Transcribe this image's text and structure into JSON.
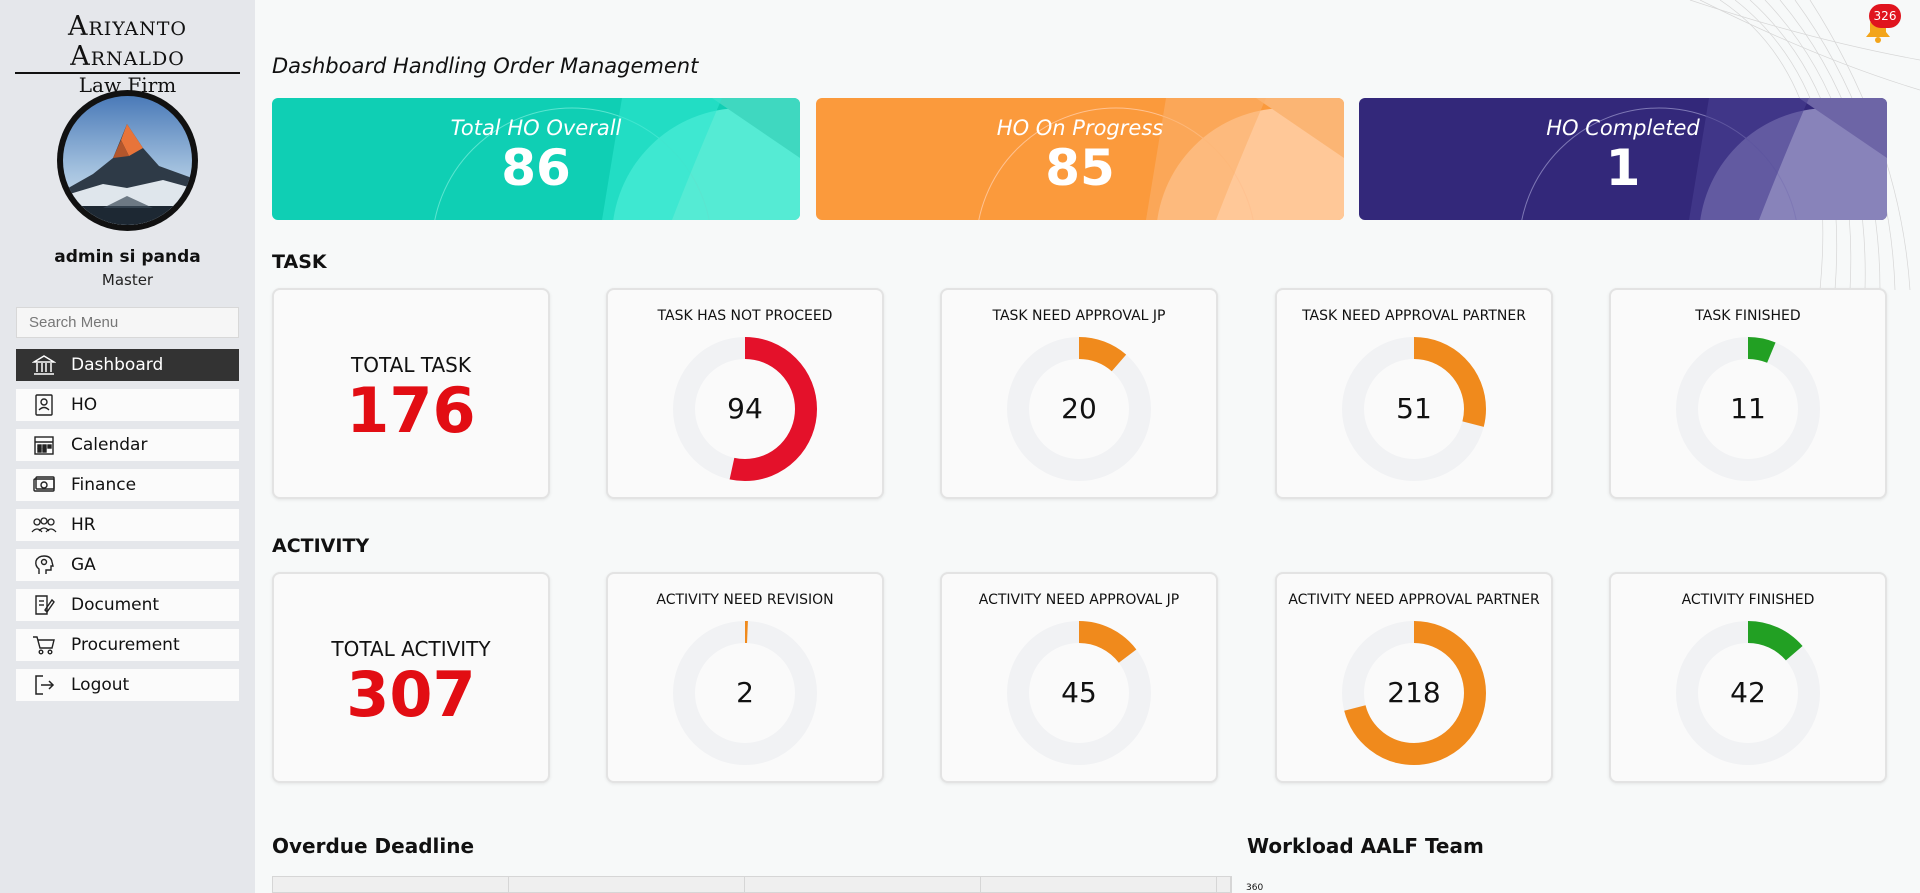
{
  "brand": {
    "line1": "Ariyanto Arnaldo",
    "line2": "Law Firm"
  },
  "user": {
    "name": "admin si panda",
    "role": "Master"
  },
  "search": {
    "placeholder": "Search Menu"
  },
  "menu": [
    {
      "label": "Dashboard",
      "icon": "bank-icon",
      "active": true
    },
    {
      "label": "HO",
      "icon": "document-person-icon"
    },
    {
      "label": "Calendar",
      "icon": "calendar-icon"
    },
    {
      "label": "Finance",
      "icon": "money-icon"
    },
    {
      "label": "HR",
      "icon": "people-icon"
    },
    {
      "label": "GA",
      "icon": "head-gear-icon"
    },
    {
      "label": "Document",
      "icon": "document-edit-icon"
    },
    {
      "label": "Procurement",
      "icon": "cart-icon"
    },
    {
      "label": "Logout",
      "icon": "logout-icon"
    }
  ],
  "header": {
    "title": "Dashboard Handling Order Management",
    "notification_count": "326"
  },
  "stats": [
    {
      "label": "Total HO Overall",
      "value": "86",
      "color": "#0fcfb4"
    },
    {
      "label": "HO On Progress",
      "value": "85",
      "color": "#fb9a3c"
    },
    {
      "label": "HO Completed",
      "value": "1",
      "color": "#33287a"
    }
  ],
  "task": {
    "section_label": "TASK",
    "total_label": "TOTAL TASK",
    "total_value": "176",
    "cards": [
      {
        "label": "TASK HAS NOT PROCEED",
        "value": "94",
        "color": "#e4112a"
      },
      {
        "label": "TASK NEED APPROVAL JP",
        "value": "20",
        "color": "#f08a1c"
      },
      {
        "label": "TASK NEED APPROVAL PARTNER",
        "value": "51",
        "color": "#f08a1c"
      },
      {
        "label": "TASK FINISHED",
        "value": "11",
        "color": "#22a023"
      }
    ]
  },
  "activity": {
    "section_label": "ACTIVITY",
    "total_label": "TOTAL ACTIVITY",
    "total_value": "307",
    "cards": [
      {
        "label": "ACTIVITY NEED REVISION",
        "value": "2",
        "color": "#f08a1c"
      },
      {
        "label": "ACTIVITY NEED APPROVAL JP",
        "value": "45",
        "color": "#f08a1c"
      },
      {
        "label": "ACTIVITY NEED APPROVAL PARTNER",
        "value": "218",
        "color": "#f08a1c"
      },
      {
        "label": "ACTIVITY FINISHED",
        "value": "42",
        "color": "#22a023"
      }
    ]
  },
  "overdue": {
    "title": "Overdue Deadline"
  },
  "workload": {
    "title": "Workload AALF Team",
    "y_top_tick": "360"
  }
}
